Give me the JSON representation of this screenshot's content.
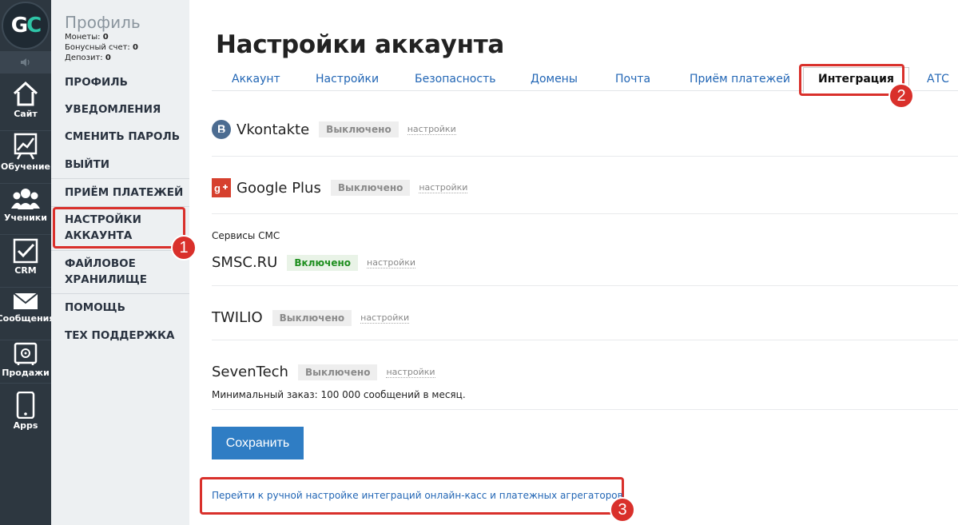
{
  "rail": {
    "logo_g": "G",
    "logo_c": "C",
    "items": [
      {
        "label": "Сайт",
        "icon": "house-icon"
      },
      {
        "label": "Обучение",
        "icon": "chart-icon"
      },
      {
        "label": "Ученики",
        "icon": "users-icon"
      },
      {
        "label": "CRM",
        "icon": "checkbox-icon"
      },
      {
        "label": "Сообщения",
        "icon": "envelope-icon"
      },
      {
        "label": "Продажи",
        "icon": "safe-icon"
      },
      {
        "label": "Apps",
        "icon": "phone-icon"
      }
    ]
  },
  "sidebar": {
    "title": "Профиль",
    "coins_label": "Монеты:",
    "coins_value": "0",
    "bonus_label": "Бонусный счет:",
    "bonus_value": "0",
    "deposit_label": "Депозит:",
    "deposit_value": "0",
    "menu": [
      "ПРОФИЛЬ",
      "УВЕДОМЛЕНИЯ",
      "СМЕНИТЬ ПАРОЛЬ",
      "ВЫЙТИ",
      "ПРИЁМ ПЛАТЕЖЕЙ",
      "НАСТРОЙКИ АККАУНТА",
      "ФАЙЛОВОЕ ХРАНИЛИЩЕ",
      "ПОМОЩЬ",
      "ТЕХ ПОДДЕРЖКА"
    ]
  },
  "page": {
    "title": "Настройки аккаунта",
    "tabs": [
      "Аккаунт",
      "Настройки",
      "Безопасность",
      "Домены",
      "Почта",
      "Приём платежей",
      "Интеграция",
      "АТС"
    ],
    "active_tab": "Интеграция"
  },
  "services": {
    "vk": {
      "name": "Vkontakte",
      "status": "Выключено",
      "settings": "настройки"
    },
    "gplus": {
      "name": "Google Plus",
      "status": "Выключено",
      "settings": "настройки"
    },
    "sms_section": "Сервисы СМС",
    "smsc": {
      "name": "SMSC.RU",
      "status": "Включено",
      "settings": "настройки"
    },
    "twilio": {
      "name": "TWILIO",
      "status": "Выключено",
      "settings": "настройки"
    },
    "seventech": {
      "name": "SevenTech",
      "status": "Выключено",
      "settings": "настройки",
      "note": "Минимальный заказ: 100 000 сообщений в месяц."
    }
  },
  "actions": {
    "save": "Сохранить",
    "manual_link": "Перейти к ручной настройке интеграций онлайн-касс и платежных агрегаторов"
  },
  "annotations": {
    "one": "1",
    "two": "2",
    "three": "3"
  },
  "colors": {
    "accent": "#2f7dc4",
    "highlight": "#d9302b",
    "rail": "#2d3740",
    "enabled": "#1f8f1f"
  }
}
